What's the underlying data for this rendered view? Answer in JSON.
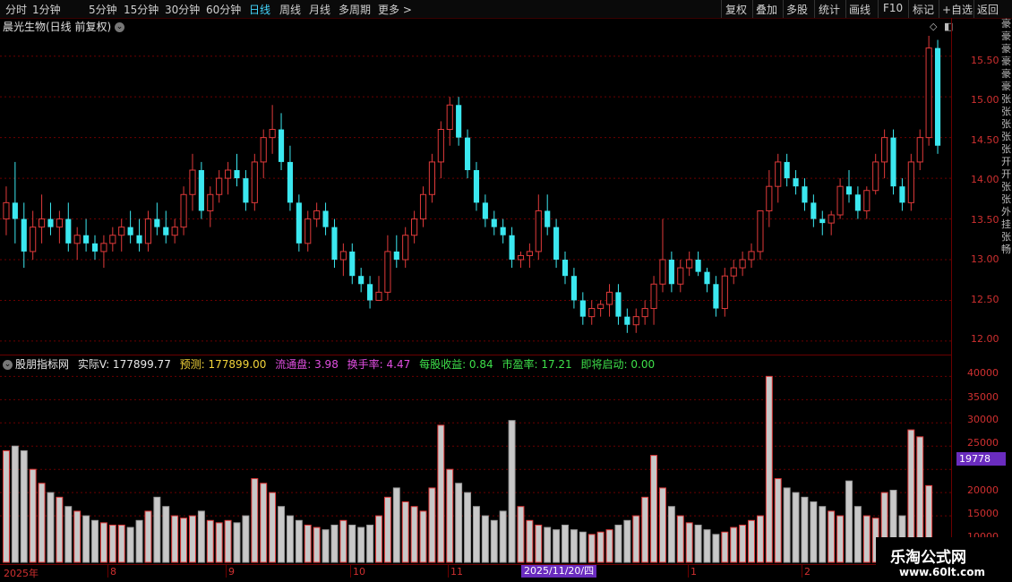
{
  "toolbar": {
    "periods": [
      "分时",
      "1分钟",
      "5分钟",
      "15分钟",
      "30分钟",
      "60分钟",
      "日线",
      "周线",
      "月线",
      "多周期",
      "更多 >"
    ],
    "active_index": 6,
    "right_items": [
      "复权",
      "叠加",
      "多股",
      "统计",
      "画线",
      "F10",
      "标记",
      "+自选",
      "返回"
    ]
  },
  "stock": {
    "title": "晨光生物(日线 前复权)"
  },
  "indicator": {
    "name": "股朋指标网",
    "actual_v": "实际V: 177899.77",
    "forecast": "预测: 177899.00",
    "float_cap": "流通盘: 3.98",
    "turnover": "换手率: 4.47",
    "eps": "每股收益: 0.84",
    "pe": "市盈率: 17.21",
    "launch": "即将启动: 0.00"
  },
  "price_axis": [
    "15.50",
    "15.00",
    "14.50",
    "14.00",
    "13.50",
    "13.00",
    "12.50",
    "12.00"
  ],
  "volume_axis": [
    "40000",
    "35000",
    "30000",
    "25000",
    "20000",
    "15000",
    "10000"
  ],
  "cursor_value": "19778",
  "dates": {
    "labels": [
      "2025年",
      "8",
      "9",
      "10",
      "11",
      "1",
      "2"
    ],
    "cursor": "2025/11/20/四"
  },
  "watermark": {
    "line1": "乐淘公式网",
    "line2": "www.60lt.com"
  },
  "right_strip": [
    "豪",
    "豪",
    "豪",
    "豪",
    "豪",
    "豪",
    "张",
    "张",
    "张",
    "张",
    "张",
    "开",
    "开",
    "张",
    "张",
    "外",
    "挂",
    "张",
    "畅"
  ],
  "colors": {
    "up": "#e03a3a",
    "down": "#3be8f0",
    "grid": "#6b0000",
    "accent": "#44d7ff"
  },
  "chart_data": {
    "type": "candlestick",
    "price_range": [
      11.9,
      15.75
    ],
    "volume_range": [
      0,
      42000
    ],
    "candles": [
      [
        13.5,
        13.9,
        13.3,
        13.7
      ],
      [
        13.7,
        14.2,
        13.2,
        13.5
      ],
      [
        13.5,
        13.7,
        12.9,
        13.1
      ],
      [
        13.1,
        13.6,
        13.0,
        13.4
      ],
      [
        13.4,
        13.8,
        13.2,
        13.5
      ],
      [
        13.5,
        13.7,
        13.3,
        13.4
      ],
      [
        13.4,
        13.6,
        13.2,
        13.5
      ],
      [
        13.5,
        13.7,
        13.1,
        13.2
      ],
      [
        13.2,
        13.4,
        13.0,
        13.3
      ],
      [
        13.3,
        13.5,
        13.1,
        13.2
      ],
      [
        13.2,
        13.3,
        13.0,
        13.1
      ],
      [
        13.1,
        13.3,
        12.9,
        13.2
      ],
      [
        13.2,
        13.4,
        13.1,
        13.3
      ],
      [
        13.3,
        13.5,
        13.1,
        13.4
      ],
      [
        13.4,
        13.6,
        13.2,
        13.3
      ],
      [
        13.3,
        13.5,
        13.1,
        13.2
      ],
      [
        13.2,
        13.6,
        13.1,
        13.5
      ],
      [
        13.5,
        13.7,
        13.3,
        13.4
      ],
      [
        13.4,
        13.6,
        13.2,
        13.3
      ],
      [
        13.3,
        13.5,
        13.2,
        13.4
      ],
      [
        13.4,
        13.9,
        13.3,
        13.8
      ],
      [
        13.8,
        14.3,
        13.6,
        14.1
      ],
      [
        14.1,
        14.2,
        13.5,
        13.6
      ],
      [
        13.6,
        13.9,
        13.4,
        13.8
      ],
      [
        13.8,
        14.1,
        13.7,
        14.0
      ],
      [
        14.0,
        14.2,
        13.8,
        14.1
      ],
      [
        14.1,
        14.3,
        13.9,
        14.0
      ],
      [
        14.0,
        14.1,
        13.6,
        13.7
      ],
      [
        13.7,
        14.3,
        13.6,
        14.2
      ],
      [
        14.2,
        14.6,
        14.0,
        14.5
      ],
      [
        14.5,
        14.9,
        14.3,
        14.6
      ],
      [
        14.6,
        14.8,
        14.1,
        14.2
      ],
      [
        14.2,
        14.4,
        13.6,
        13.7
      ],
      [
        13.7,
        13.8,
        13.1,
        13.2
      ],
      [
        13.2,
        13.6,
        13.1,
        13.5
      ],
      [
        13.5,
        13.7,
        13.4,
        13.6
      ],
      [
        13.6,
        13.7,
        13.3,
        13.4
      ],
      [
        13.4,
        13.5,
        12.9,
        13.0
      ],
      [
        13.0,
        13.2,
        12.8,
        13.1
      ],
      [
        13.1,
        13.2,
        12.7,
        12.8
      ],
      [
        12.8,
        12.9,
        12.6,
        12.7
      ],
      [
        12.7,
        12.8,
        12.4,
        12.5
      ],
      [
        12.5,
        12.8,
        12.5,
        12.6
      ],
      [
        12.6,
        13.3,
        12.5,
        13.1
      ],
      [
        13.1,
        13.3,
        12.9,
        13.0
      ],
      [
        13.0,
        13.4,
        12.9,
        13.3
      ],
      [
        13.3,
        13.6,
        13.2,
        13.5
      ],
      [
        13.5,
        13.9,
        13.4,
        13.8
      ],
      [
        13.8,
        14.3,
        13.7,
        14.2
      ],
      [
        14.2,
        14.7,
        14.0,
        14.6
      ],
      [
        14.6,
        15.0,
        14.4,
        14.9
      ],
      [
        14.9,
        15.0,
        14.4,
        14.5
      ],
      [
        14.5,
        14.6,
        14.0,
        14.1
      ],
      [
        14.1,
        14.2,
        13.6,
        13.7
      ],
      [
        13.7,
        13.8,
        13.4,
        13.5
      ],
      [
        13.5,
        13.6,
        13.3,
        13.4
      ],
      [
        13.4,
        13.5,
        13.2,
        13.3
      ],
      [
        13.3,
        13.4,
        12.9,
        13.0
      ],
      [
        13.0,
        13.1,
        12.9,
        13.05
      ],
      [
        13.05,
        13.2,
        12.9,
        13.1
      ],
      [
        13.1,
        13.8,
        13.0,
        13.6
      ],
      [
        13.6,
        13.8,
        13.3,
        13.4
      ],
      [
        13.4,
        13.5,
        12.9,
        13.0
      ],
      [
        13.0,
        13.1,
        12.7,
        12.8
      ],
      [
        12.8,
        12.9,
        12.4,
        12.5
      ],
      [
        12.5,
        12.6,
        12.2,
        12.3
      ],
      [
        12.3,
        12.5,
        12.2,
        12.4
      ],
      [
        12.4,
        12.5,
        12.3,
        12.45
      ],
      [
        12.45,
        12.7,
        12.3,
        12.6
      ],
      [
        12.6,
        12.7,
        12.2,
        12.3
      ],
      [
        12.3,
        12.4,
        12.1,
        12.2
      ],
      [
        12.2,
        12.4,
        12.1,
        12.3
      ],
      [
        12.3,
        12.5,
        12.2,
        12.4
      ],
      [
        12.4,
        12.8,
        12.2,
        12.7
      ],
      [
        12.7,
        13.5,
        12.6,
        13.0
      ],
      [
        13.0,
        13.1,
        12.6,
        12.7
      ],
      [
        12.7,
        13.0,
        12.6,
        12.9
      ],
      [
        12.9,
        13.1,
        12.8,
        13.0
      ],
      [
        13.0,
        13.1,
        12.8,
        12.85
      ],
      [
        12.85,
        12.9,
        12.6,
        12.7
      ],
      [
        12.7,
        12.8,
        12.3,
        12.4
      ],
      [
        12.4,
        12.9,
        12.3,
        12.8
      ],
      [
        12.8,
        13.0,
        12.7,
        12.9
      ],
      [
        12.9,
        13.1,
        12.8,
        13.0
      ],
      [
        13.0,
        13.2,
        12.9,
        13.1
      ],
      [
        13.1,
        13.4,
        13.0,
        13.6
      ],
      [
        13.6,
        14.1,
        13.4,
        13.9
      ],
      [
        13.9,
        14.3,
        13.7,
        14.2
      ],
      [
        14.2,
        14.3,
        13.9,
        14.0
      ],
      [
        14.0,
        14.1,
        13.8,
        13.9
      ],
      [
        13.9,
        14.0,
        13.6,
        13.7
      ],
      [
        13.7,
        13.8,
        13.4,
        13.5
      ],
      [
        13.5,
        13.6,
        13.3,
        13.45
      ],
      [
        13.45,
        13.6,
        13.3,
        13.55
      ],
      [
        13.55,
        14.0,
        13.5,
        13.9
      ],
      [
        13.9,
        14.1,
        13.7,
        13.8
      ],
      [
        13.8,
        13.9,
        13.5,
        13.6
      ],
      [
        13.6,
        13.9,
        13.5,
        13.85
      ],
      [
        13.85,
        14.3,
        13.8,
        14.2
      ],
      [
        14.2,
        14.6,
        14.0,
        14.5
      ],
      [
        14.5,
        14.6,
        13.8,
        13.9
      ],
      [
        13.9,
        14.0,
        13.6,
        13.7
      ],
      [
        13.7,
        14.3,
        13.6,
        14.2
      ],
      [
        14.2,
        14.6,
        14.1,
        14.5
      ],
      [
        14.5,
        15.75,
        14.4,
        15.6
      ],
      [
        15.6,
        15.7,
        14.3,
        14.4
      ]
    ],
    "volumes": [
      24000,
      25000,
      24000,
      20000,
      17000,
      15000,
      14000,
      12000,
      11000,
      10000,
      9000,
      8500,
      8000,
      8000,
      7500,
      9000,
      11000,
      14000,
      12000,
      10000,
      9500,
      10000,
      11000,
      9000,
      8500,
      9000,
      8500,
      10000,
      18000,
      17000,
      15000,
      12000,
      10000,
      9000,
      8000,
      7500,
      7000,
      8000,
      9000,
      8000,
      7500,
      8000,
      10000,
      14000,
      16000,
      13000,
      12000,
      11000,
      16000,
      29500,
      20000,
      17000,
      15000,
      12000,
      10000,
      9000,
      11000,
      30500,
      12000,
      9000,
      8000,
      7500,
      7000,
      8000,
      7000,
      6500,
      6000,
      6500,
      7000,
      8000,
      9000,
      10000,
      14000,
      23000,
      16000,
      12000,
      10000,
      8500,
      8000,
      7000,
      6000,
      6500,
      7500,
      8000,
      9000,
      10000,
      40000,
      18000,
      16000,
      15000,
      14000,
      13000,
      12000,
      11000,
      10000,
      17500,
      12000,
      10000,
      9500,
      15000,
      15500,
      10000,
      28500,
      27000,
      16500
    ]
  }
}
